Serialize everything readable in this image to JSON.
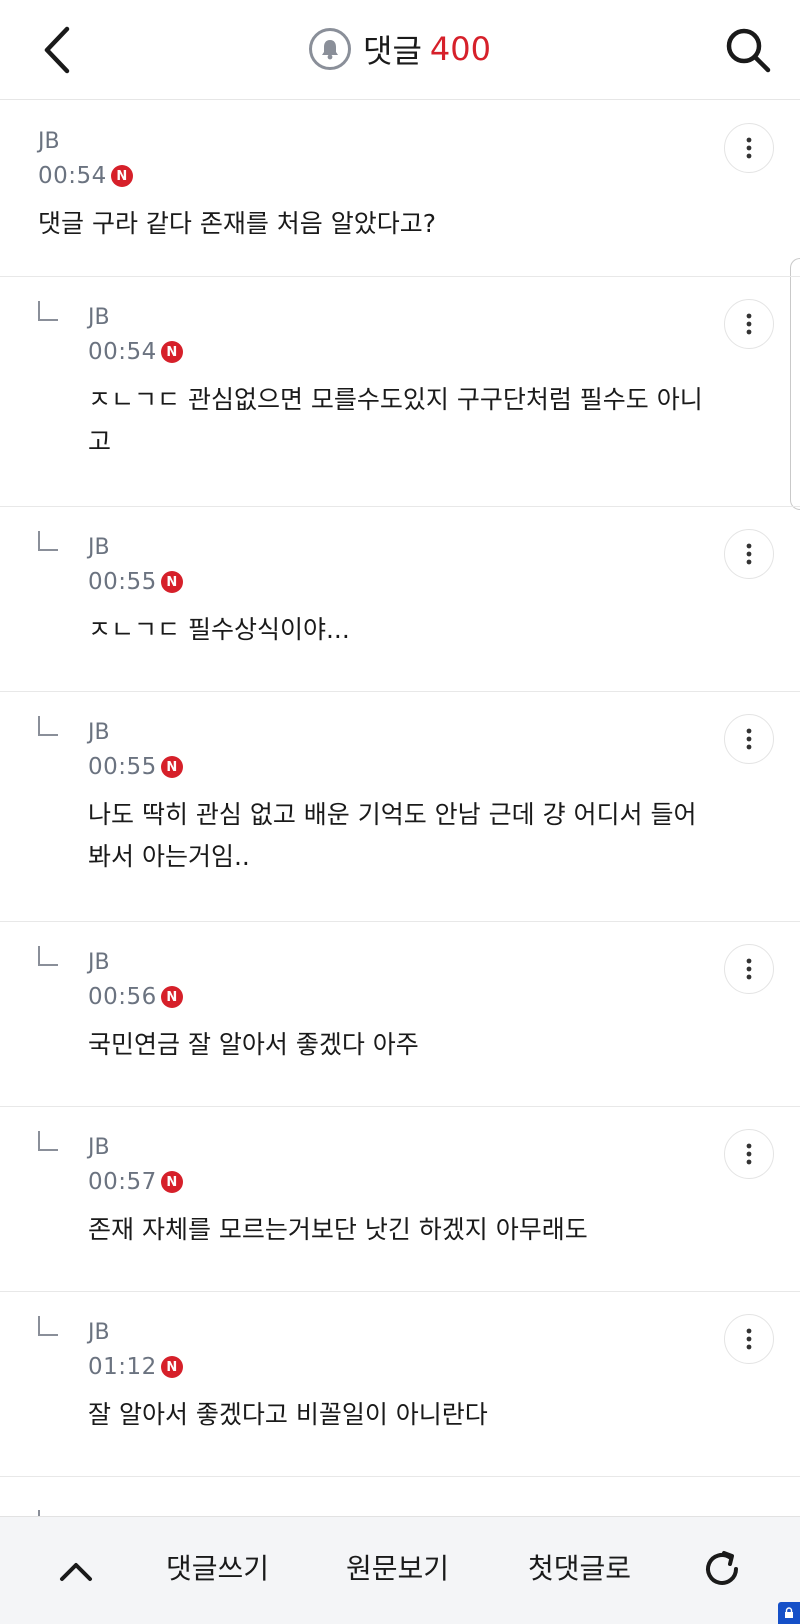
{
  "header": {
    "title": "댓글",
    "count": "400",
    "back_icon": "chevron-left-icon",
    "bell_icon": "bell-icon",
    "search_icon": "search-icon"
  },
  "comments": [
    {
      "author": "JB",
      "time": "00:54",
      "badge": "N",
      "text": "댓글 구라 같다 존재를 처음 알았다고?",
      "type": "top"
    },
    {
      "author": "JB",
      "time": "00:54",
      "badge": "N",
      "text": "ㅈㄴㄱㄷ 관심없으면 모를수도있지 구구단처럼 필수도 아니고",
      "type": "reply"
    },
    {
      "author": "JB",
      "time": "00:55",
      "badge": "N",
      "text": "ㅈㄴㄱㄷ 필수상식이야...",
      "type": "reply"
    },
    {
      "author": "JB",
      "time": "00:55",
      "badge": "N",
      "text": "나도 딱히 관심 없고 배운 기억도 안남 근데 걍 어디서 들어봐서 아는거임..",
      "type": "reply"
    },
    {
      "author": "JB",
      "time": "00:56",
      "badge": "N",
      "text": "국민연금 잘 알아서 좋겠다 아주",
      "type": "reply"
    },
    {
      "author": "JB",
      "time": "00:57",
      "badge": "N",
      "text": "존재 자체를 모르는거보단 낫긴 하겠지 아무래도",
      "type": "reply"
    },
    {
      "author": "JB",
      "time": "01:12",
      "badge": "N",
      "text": "잘 알아서 좋겠다고 비꼴일이 아니란다",
      "type": "reply"
    }
  ],
  "bottom_bar": {
    "up_icon": "chevron-up-icon",
    "write_label": "댓글쓰기",
    "origin_label": "원문보기",
    "first_label": "첫댓글로",
    "refresh_icon": "refresh-icon"
  },
  "colors": {
    "accent_red": "#d6202a",
    "meta_gray": "#6b7380",
    "bar_bg": "#f4f5f7"
  }
}
